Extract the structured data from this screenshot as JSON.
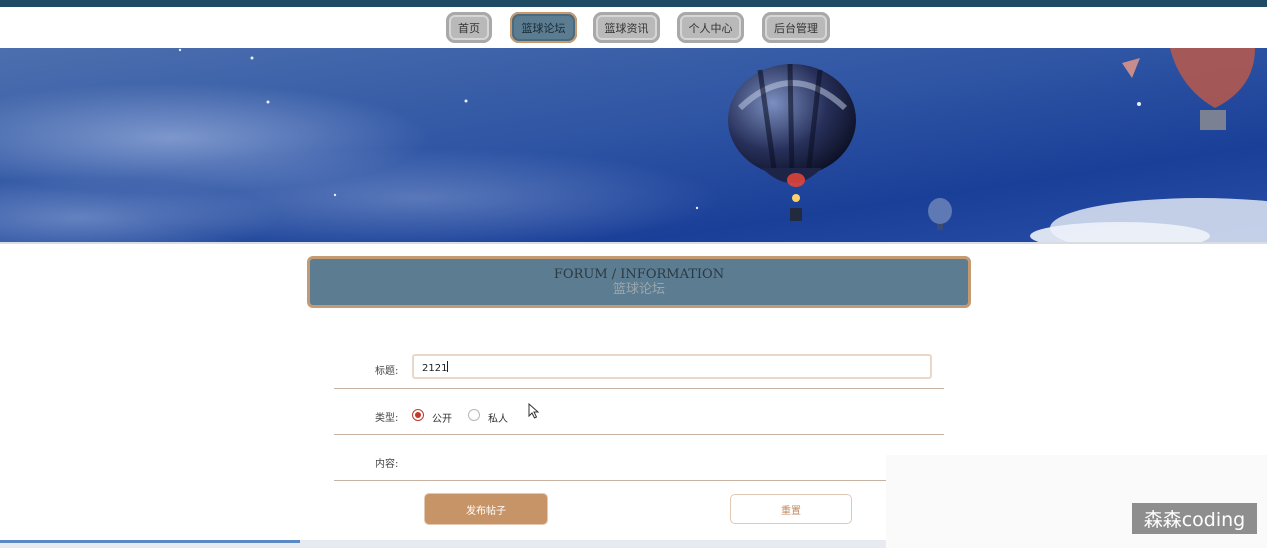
{
  "colors": {
    "top_stripe": "#1f4a63",
    "nav_active": "#5b7c91",
    "panel_bg": "#5c7c91",
    "panel_border": "#c49a72",
    "submit_bg": "#c79467",
    "radio_checked": "#c0392b"
  },
  "nav": {
    "items": [
      {
        "label": "首页",
        "icon": null,
        "active": false
      },
      {
        "label": "篮球论坛",
        "icon": null,
        "active": true
      },
      {
        "label": "篮球资讯",
        "icon": null,
        "active": false
      },
      {
        "label": "个人中心",
        "icon": null,
        "active": false
      },
      {
        "label": "后台管理",
        "icon": null,
        "active": false
      }
    ]
  },
  "banner": {
    "image": "night-sky-hot-air-balloons"
  },
  "section": {
    "title_en": "FORUM / INFORMATION",
    "title_cn": "篮球论坛"
  },
  "form": {
    "title_label": "标题:",
    "title_value": "2121",
    "type_label": "类型:",
    "type_options": [
      "公开",
      "私人"
    ],
    "type_selected": "公开",
    "content_label": "内容:",
    "submit_label": "发布帖子",
    "reset_label": "重置"
  },
  "watermark": {
    "text": "森森coding"
  }
}
